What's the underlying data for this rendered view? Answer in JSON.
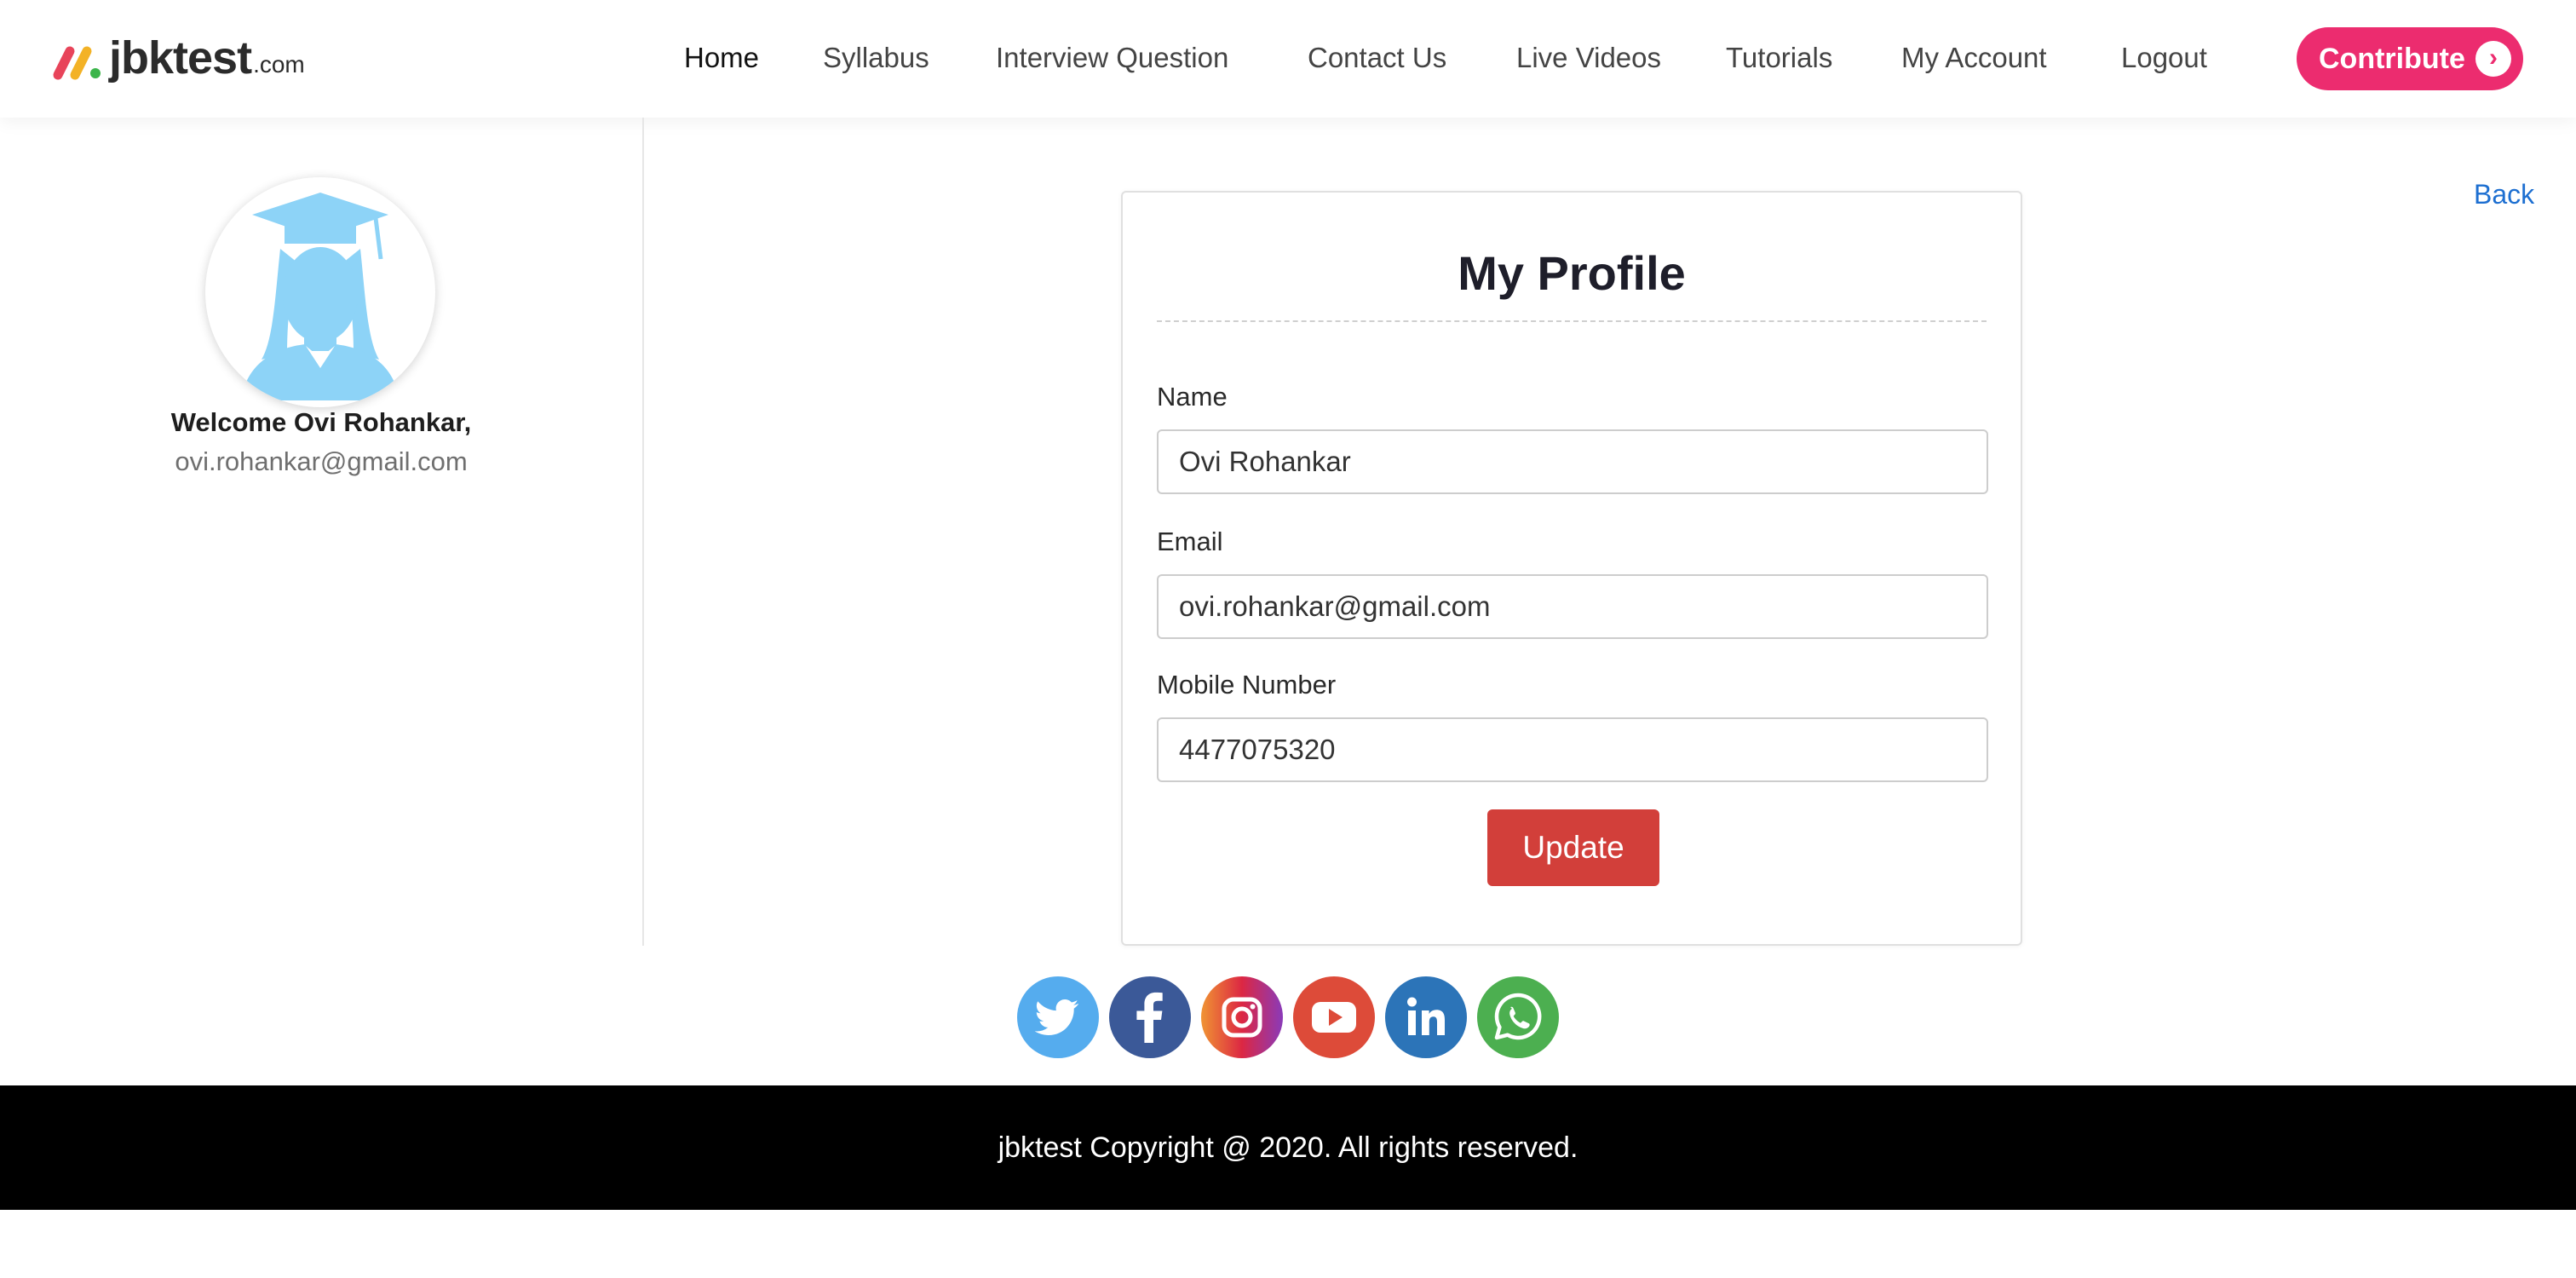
{
  "brand": {
    "name": "jbktest",
    "tld": ".com"
  },
  "nav": {
    "items": [
      {
        "label": "Home",
        "active": true
      },
      {
        "label": "Syllabus"
      },
      {
        "label": "Interview Question"
      },
      {
        "label": "Contact Us"
      },
      {
        "label": "Live Videos"
      },
      {
        "label": "Tutorials"
      },
      {
        "label": "My Account"
      },
      {
        "label": "Logout"
      }
    ],
    "contribute_label": "Contribute",
    "contribute_icon": "chevron-right-icon"
  },
  "sidebar": {
    "avatar_icon": "graduate-avatar-icon",
    "welcome": "Welcome Ovi Rohankar,",
    "email": "ovi.rohankar@gmail.com"
  },
  "main": {
    "back_link": "Back",
    "title": "My Profile",
    "fields": {
      "name": {
        "label": "Name",
        "value": "Ovi Rohankar"
      },
      "email": {
        "label": "Email",
        "value": "ovi.rohankar@gmail.com"
      },
      "mobile": {
        "label": "Mobile Number",
        "value": "4477075320"
      }
    },
    "update_label": "Update"
  },
  "social": [
    {
      "icon": "twitter-icon",
      "color": "#55acee"
    },
    {
      "icon": "facebook-icon",
      "color": "#3b5998"
    },
    {
      "icon": "instagram-icon",
      "color": "#c13584"
    },
    {
      "icon": "youtube-icon",
      "color": "#dd4b39"
    },
    {
      "icon": "linkedin-icon",
      "color": "#2c74b8"
    },
    {
      "icon": "whatsapp-icon",
      "color": "#4caf50"
    }
  ],
  "colors": {
    "contribute": "#ec2c6f",
    "update_button": "#d23f3a",
    "link": "#1d6fd1",
    "avatar": "#8dd3f7",
    "footer_bg": "#000000"
  },
  "footer": {
    "copyright": "jbktest Copyright @ 2020. All rights reserved."
  }
}
